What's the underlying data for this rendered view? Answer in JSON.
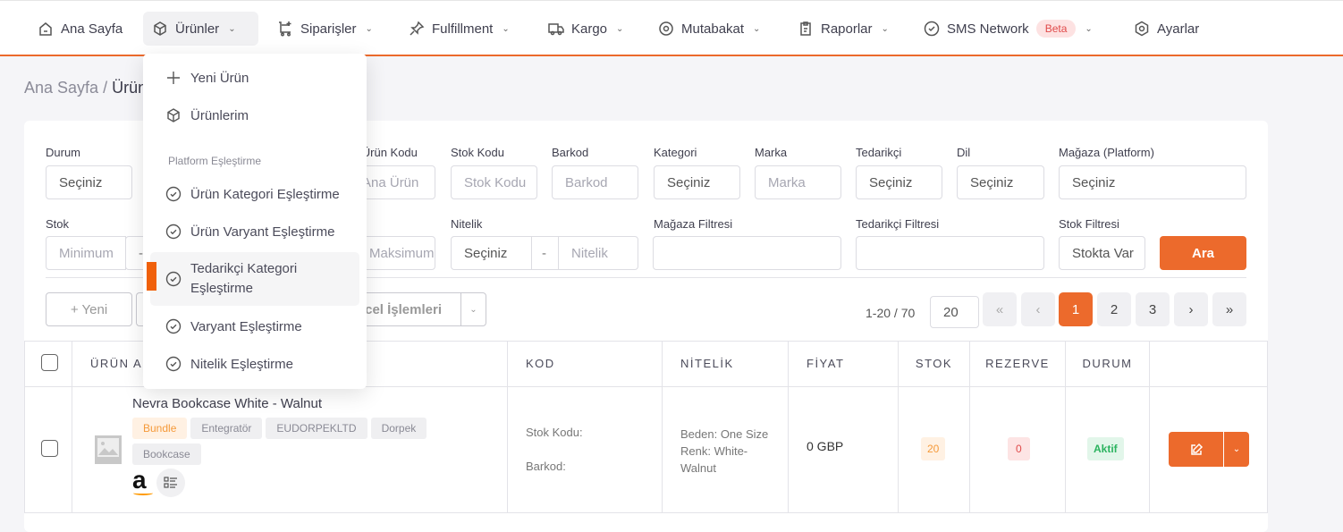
{
  "nav": {
    "items": [
      {
        "label": "Ana Sayfa",
        "icon": "home-icon"
      },
      {
        "label": "Ürünler",
        "icon": "box-icon"
      },
      {
        "label": "Siparişler",
        "icon": "cart-icon"
      },
      {
        "label": "Fulfillment",
        "icon": "pin-icon"
      },
      {
        "label": "Kargo",
        "icon": "truck-icon"
      },
      {
        "label": "Mutabakat",
        "icon": "settings-eye-icon"
      },
      {
        "label": "Raporlar",
        "icon": "clipboard-icon"
      },
      {
        "label": "SMS Network",
        "icon": "check-circle-icon",
        "badge": "Beta"
      },
      {
        "label": "Ayarlar",
        "icon": "hexagon-gear-icon"
      }
    ],
    "accent": "#ec6a2c"
  },
  "breadcrumb": {
    "home": "Ana Sayfa",
    "sep": "/",
    "current": "Ürünler"
  },
  "menu": {
    "new_product": "Yeni Ürün",
    "my_products": "Ürünlerim",
    "section": "Platform Eşleştirme",
    "items": [
      "Ürün Kategori Eşleştirme",
      "Ürün Varyant Eşleştirme",
      "Tedarikçi Kategori Eşleştirme",
      "Varyant Eşleştirme",
      "Nitelik Eşleştirme"
    ]
  },
  "filters": {
    "durum": {
      "label": "Durum",
      "value": "Seçiniz"
    },
    "ana_urun_kodu": {
      "label": "Ana Ürün Kodu",
      "placeholder": "Ana Ürün"
    },
    "stok_kodu": {
      "label": "Stok Kodu",
      "placeholder": "Stok Kodu"
    },
    "barkod": {
      "label": "Barkod",
      "placeholder": "Barkod"
    },
    "kategori": {
      "label": "Kategori",
      "value": "Seçiniz"
    },
    "marka": {
      "label": "Marka",
      "placeholder": "Marka"
    },
    "tedarikci": {
      "label": "Tedarikçi",
      "value": "Seçiniz"
    },
    "dil": {
      "label": "Dil",
      "value": "Seçiniz"
    },
    "magaza": {
      "label": "Mağaza (Platform)",
      "value": "Seçiniz"
    },
    "stok": {
      "label": "Stok",
      "min": "Minimum",
      "sep": "-",
      "max": "Maksimum"
    },
    "nitelik": {
      "label": "Nitelik",
      "value": "Seçiniz",
      "sep": "-",
      "placeholder": "Nitelik"
    },
    "magaza_filtresi": {
      "label": "Mağaza Filtresi"
    },
    "tedarikci_filtresi": {
      "label": "Tedarikçi Filtresi"
    },
    "stok_filtresi": {
      "label": "Stok Filtresi",
      "value": "Stokta Var"
    },
    "search": "Ara"
  },
  "toolbar": {
    "new": "+ Yeni",
    "excel": "Excel İşlemleri"
  },
  "pagination": {
    "range": "1-20 / 70",
    "per_page": "20",
    "first": "«",
    "prev": "‹",
    "pages": [
      "1",
      "2",
      "3"
    ],
    "current": "1",
    "next": "›",
    "last": "»"
  },
  "table": {
    "headers": [
      "ÜRÜN ADI",
      "KOD",
      "NİTELİK",
      "FİYAT",
      "STOK",
      "REZERVE",
      "DURUM"
    ],
    "rows": [
      {
        "name": "Nevra Bookcase White - Walnut",
        "tags": [
          "Bundle",
          "Entegratör",
          "EUDORPEKLTD",
          "Dorpek",
          "Bookcase"
        ],
        "stock_code": "Stok Kodu:",
        "barcode": "Barkod:",
        "attr1": "Beden: One Size",
        "attr2": "Renk: White-Walnut",
        "price": "0 GBP",
        "stock": "20",
        "reserve": "0",
        "status": "Aktif"
      }
    ]
  }
}
